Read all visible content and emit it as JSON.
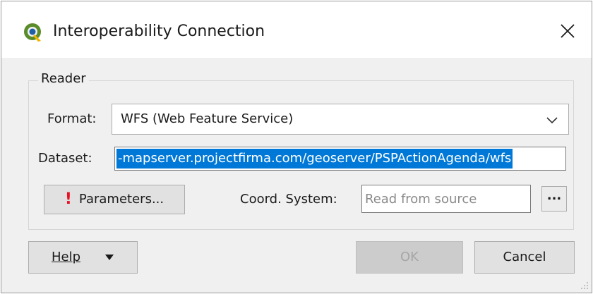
{
  "window": {
    "title": "Interoperability Connection",
    "icon": "qgis-logo-icon",
    "close_glyph": "✕"
  },
  "reader": {
    "group_label": "Reader",
    "format_label": "Format:",
    "format_value": "WFS (Web Feature Service)",
    "dataset_label": "Dataset:",
    "dataset_value": "-mapserver.projectfirma.com/geoserver/PSPActionAgenda/wfs",
    "parameters_label": "Parameters...",
    "parameters_warning_glyph": "!",
    "coord_label": "Coord. System:",
    "coord_placeholder": "Read from source",
    "browse_label": "..."
  },
  "footer": {
    "help_label": "Help",
    "ok_label": "OK",
    "cancel_label": "Cancel"
  },
  "colors": {
    "selection": "#0078d7",
    "warning": "#e81123",
    "dialog_bg": "#f0f0f0"
  }
}
